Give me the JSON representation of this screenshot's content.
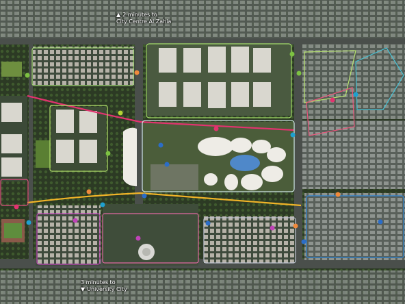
{
  "captions": {
    "north": {
      "icon": "▲",
      "line1": "2 minutes to",
      "line2": "City Centre Al Zahia"
    },
    "south": {
      "icon": "▼",
      "line1": "3 minutes to",
      "line2": "University City"
    }
  },
  "colors": {
    "magenta_boulevard": "#e2336f",
    "yellow_boulevard": "#f1b428",
    "zone_green": "#9cd46c",
    "zone_cyan": "#46c2d6",
    "zone_purple": "#c043b8",
    "zone_blue": "#2c84d3"
  },
  "icons": [
    "arrow-up-icon",
    "arrow-down-icon"
  ]
}
